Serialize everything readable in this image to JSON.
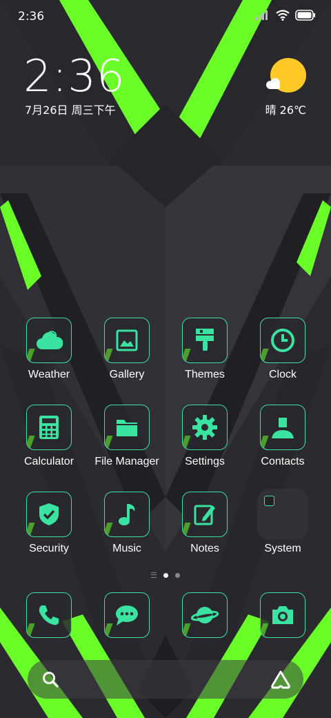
{
  "status_bar": {
    "time": "2:36",
    "signal_icon": "signal-icon",
    "wifi_icon": "wifi-icon",
    "battery_icon": "battery-icon"
  },
  "clock_widget": {
    "time": "2:36",
    "date": "7月26日 周三下午"
  },
  "weather_widget": {
    "icon": "sun-cloud-icon",
    "text": "晴 26℃"
  },
  "colors": {
    "accent": "#3be3a0",
    "wallpaper_green": "#6bff2a",
    "sun": "#ffc928",
    "background": "#2b2b30"
  },
  "apps": [
    {
      "label": "Weather",
      "icon": "weather-icon"
    },
    {
      "label": "Gallery",
      "icon": "gallery-icon"
    },
    {
      "label": "Themes",
      "icon": "paintbrush-icon"
    },
    {
      "label": "Clock",
      "icon": "clock-icon"
    },
    {
      "label": "Calculator",
      "icon": "calculator-icon"
    },
    {
      "label": "File Manager",
      "icon": "folder-icon"
    },
    {
      "label": "Settings",
      "icon": "gear-icon"
    },
    {
      "label": "Contacts",
      "icon": "contact-icon"
    },
    {
      "label": "Security",
      "icon": "shield-icon"
    },
    {
      "label": "Music",
      "icon": "music-note-icon"
    },
    {
      "label": "Notes",
      "icon": "notes-icon"
    },
    {
      "label": "System",
      "icon": "folder-icon"
    }
  ],
  "page_indicator": {
    "pages": 2,
    "active": 1
  },
  "dock": [
    {
      "icon": "phone-icon"
    },
    {
      "icon": "message-icon"
    },
    {
      "icon": "browser-planet-icon"
    },
    {
      "icon": "camera-icon"
    }
  ],
  "search_bar": {
    "search_icon": "search-icon",
    "assistant_icon": "assistant-icon"
  }
}
